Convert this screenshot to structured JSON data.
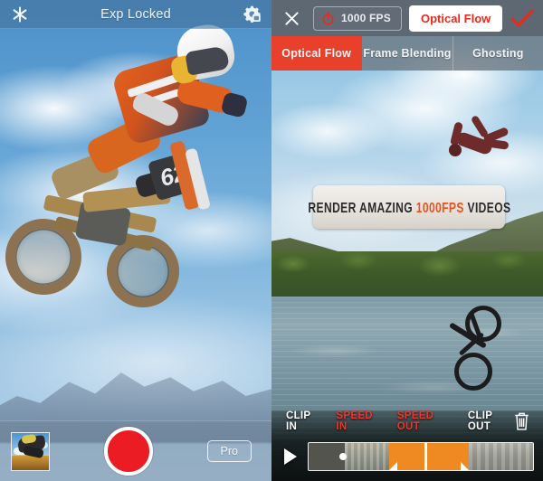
{
  "app": {
    "left_panel": {
      "header": {
        "flash_icon": "sparkle-icon",
        "title": "Exp Locked",
        "settings_icon": "gear-lock-icon"
      },
      "scene": {
        "description": "Motocross rider mid-air over blue sky",
        "bike_number": "62"
      },
      "bottom_bar": {
        "gallery_thumbnail": "gallery-thumbnail",
        "record_button": "record-button",
        "pro_label": "Pro"
      }
    },
    "right_panel": {
      "header": {
        "close_icon": "close-icon",
        "fps_icon": "stopwatch-icon",
        "fps_label": "1000 FPS",
        "mode_label": "Optical Flow",
        "confirm_icon": "checkmark-icon"
      },
      "tabs": [
        {
          "label": "Optical Flow",
          "active": true
        },
        {
          "label": "Frame Blending",
          "active": false
        },
        {
          "label": "Ghosting",
          "active": false
        }
      ],
      "banner": {
        "text_before": "RENDER AMAZING ",
        "highlight": "1000FPS",
        "text_after": " VIDEOS"
      },
      "scene": {
        "description": "Person falling from sky into a lake with bicycle"
      },
      "controls": {
        "clip_in": "CLIP IN",
        "speed_in": "SPEED IN",
        "speed_out": "SPEED OUT",
        "clip_out": "CLIP OUT",
        "trash_icon": "trash-icon",
        "play_icon": "play-icon",
        "timeline": "timeline-scrubber"
      }
    }
  },
  "colors": {
    "accent_red": "#e8402b",
    "mode_red": "#e8291d",
    "label_red": "#f0352a",
    "timeline_orange": "#ef8a22",
    "record_red": "#ec1c24",
    "header_gray": "#5e6872",
    "tab_gray": "#6e7a84"
  }
}
